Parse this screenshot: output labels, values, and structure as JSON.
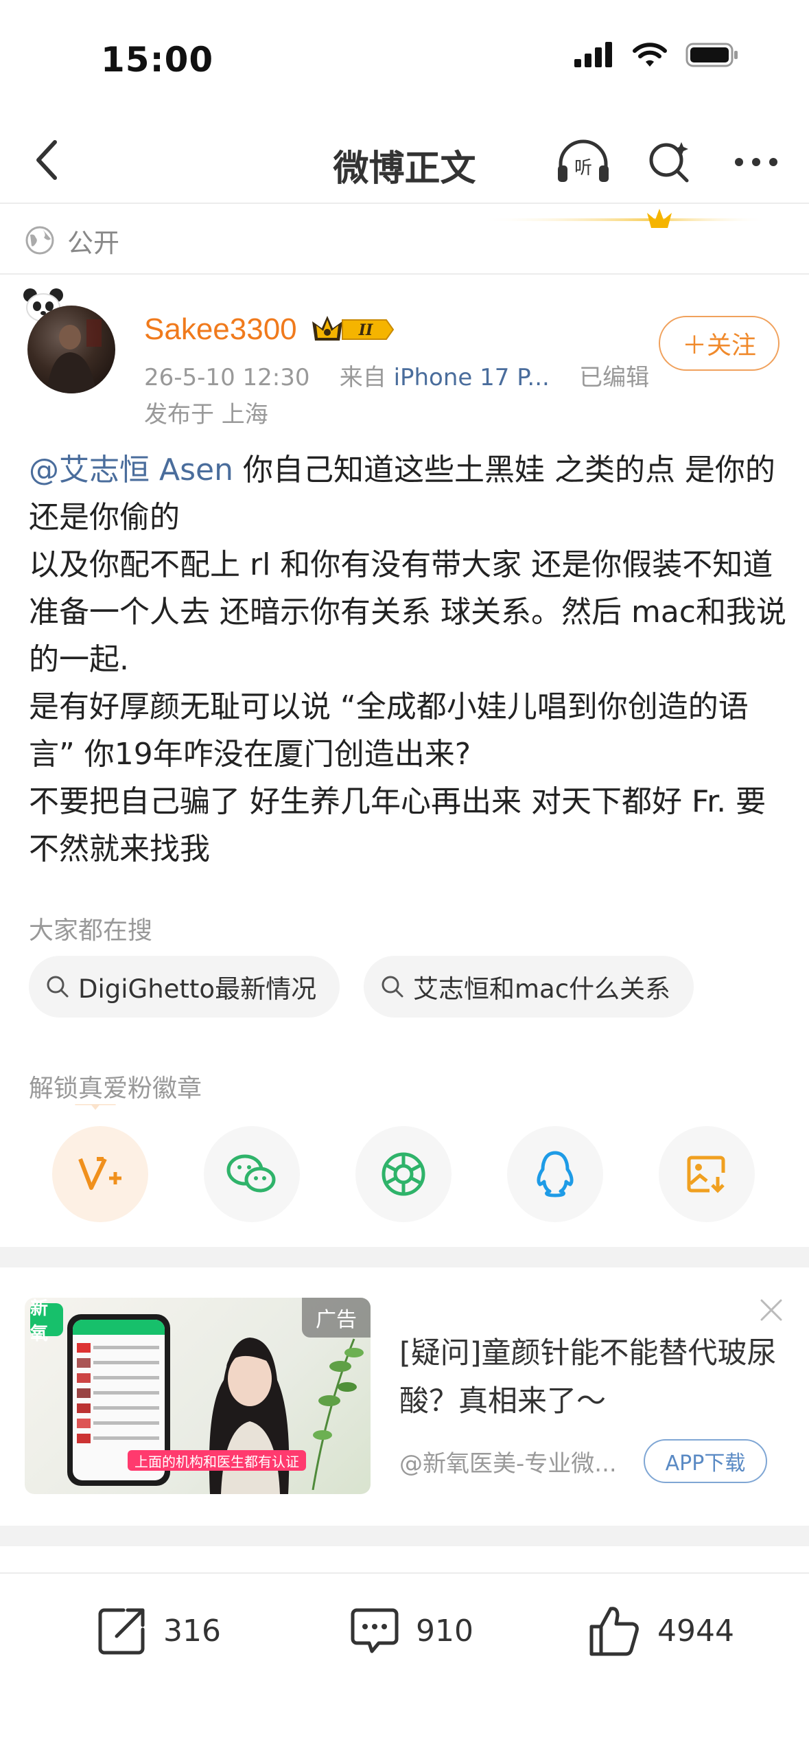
{
  "status_bar": {
    "time": "15:00"
  },
  "nav": {
    "title": "微博正文"
  },
  "post_meta": {
    "visibility": "公开"
  },
  "author": {
    "name": "Sakee3300",
    "date": "26-5-10 12:30",
    "from_label": "来自",
    "source": "iPhone 17 P...",
    "edited": "已编辑",
    "location": "发布于 上海",
    "follow_label": "＋关注",
    "vip_level": "II"
  },
  "post": {
    "mention": "@艾志恒 Asen",
    "lines": [
      " 你自己知道这些土黑娃 之类的点 是你的还是你偷的",
      "以及你配不配上 rl 和你有没有带大家 还是你假装不知道 准备一个人去 还暗示你有关系 球关系。然后 mac和我说的一起.",
      "是有好厚颜无耻可以说 “全成都小娃儿唱到你创造的语言” 你19年咋没在厦门创造出来?",
      "不要把自己骗了 好生养几年心再出来 对天下都好 Fr. 要不然就来找我"
    ]
  },
  "hot_search": {
    "label": "大家都在搜",
    "chips": [
      "DigiGhetto最新情况",
      "艾志恒和mac什么关系"
    ]
  },
  "share": {
    "label": "解锁真爱粉徽章",
    "targets": [
      "vplus-icon",
      "wechat-icon",
      "moments-icon",
      "qq-icon",
      "save-image-icon"
    ]
  },
  "ad": {
    "badge": "广告",
    "logo_text": "新氧",
    "title": "[疑问]童颜针能不能替代玻尿酸？真相来了～",
    "source": "@新氧医美-专业微...",
    "button": "APP下载",
    "image_caption": "上面的机构和医生都有认证"
  },
  "actions": {
    "repost_count": "316",
    "comment_count": "910",
    "like_count": "4944"
  },
  "colors": {
    "username": "#f07a1c",
    "link": "#4a6d9c",
    "follow": "#f08a2c",
    "ad_button": "#5a8ac4"
  }
}
